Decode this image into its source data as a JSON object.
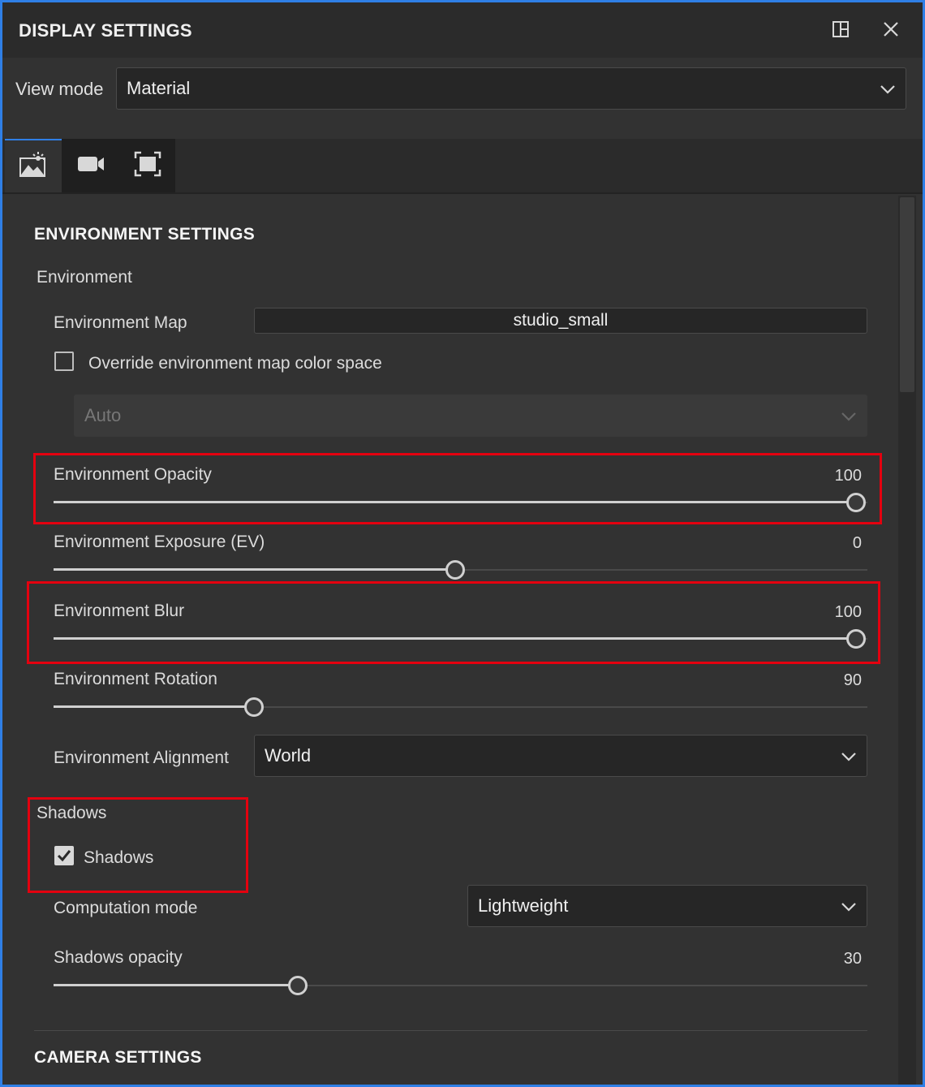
{
  "panel": {
    "title": "DISPLAY SETTINGS",
    "view_mode_label": "View mode",
    "view_mode_value": "Material"
  },
  "tabs": [
    {
      "name": "environment",
      "icon": "image-sparkle-icon",
      "active": true
    },
    {
      "name": "camera",
      "icon": "video-camera-icon",
      "active": false
    },
    {
      "name": "frame",
      "icon": "fit-frame-icon",
      "active": false
    }
  ],
  "environment": {
    "section_title": "ENVIRONMENT SETTINGS",
    "group_label": "Environment",
    "map_label": "Environment Map",
    "map_value": "studio_small",
    "override_label": "Override environment map color space",
    "override_checked": false,
    "color_space_value": "Auto",
    "alignment_label": "Environment Alignment",
    "alignment_value": "World",
    "sliders": [
      {
        "key": "opacity",
        "label": "Environment Opacity",
        "value": "100",
        "fraction": 1.0
      },
      {
        "key": "exposure",
        "label": "Environment Exposure (EV)",
        "value": "0",
        "fraction": 0.5
      },
      {
        "key": "blur",
        "label": "Environment Blur",
        "value": "100",
        "fraction": 1.0
      },
      {
        "key": "rotation",
        "label": "Environment Rotation",
        "value": "90",
        "fraction": 0.25
      }
    ]
  },
  "shadows": {
    "group_label": "Shadows",
    "checkbox_label": "Shadows",
    "checked": true,
    "computation_label": "Computation mode",
    "computation_value": "Lightweight",
    "opacity_label": "Shadows opacity",
    "opacity_value": "30",
    "opacity_fraction": 0.3
  },
  "camera": {
    "section_title": "CAMERA SETTINGS"
  },
  "colors": {
    "accent": "#2f7fe6",
    "highlight": "#e4000f",
    "background": "#323232"
  }
}
